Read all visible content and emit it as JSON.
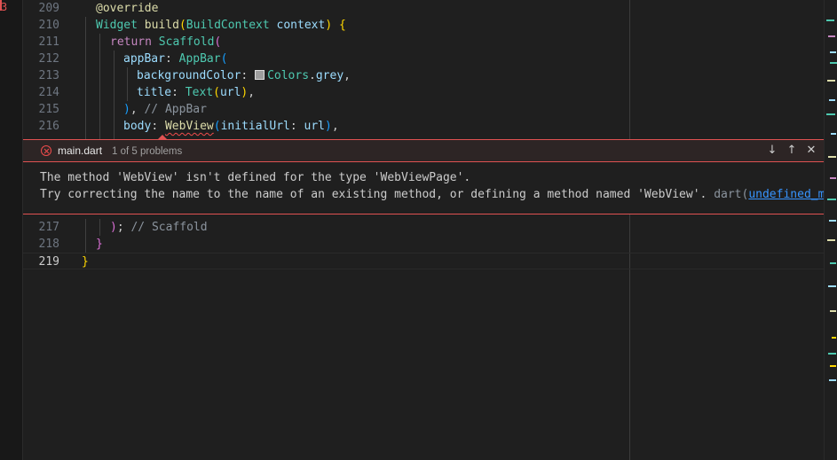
{
  "gutter": {
    "badge": "3"
  },
  "lines": [
    {
      "num": "209",
      "tokens": [
        {
          "t": "@override",
          "c": "anno"
        }
      ]
    },
    {
      "num": "210",
      "tokens": [
        {
          "t": "Widget ",
          "c": "cls"
        },
        {
          "t": "build",
          "c": "fn"
        },
        {
          "t": "(",
          "c": "br1"
        },
        {
          "t": "BuildContext ",
          "c": "cls"
        },
        {
          "t": "context",
          "c": "prm"
        },
        {
          "t": ") ",
          "c": "br1"
        },
        {
          "t": "{",
          "c": "br1"
        }
      ]
    },
    {
      "num": "211",
      "tokens": [
        {
          "t": "return ",
          "c": "kw"
        },
        {
          "t": "Scaffold",
          "c": "cls"
        },
        {
          "t": "(",
          "c": "br2"
        }
      ]
    },
    {
      "num": "212",
      "tokens": [
        {
          "t": "appBar",
          "c": "prm"
        },
        {
          "t": ": ",
          "c": "pn"
        },
        {
          "t": "AppBar",
          "c": "cls"
        },
        {
          "t": "(",
          "c": "br3"
        }
      ]
    },
    {
      "num": "213",
      "tokens": [
        {
          "t": "backgroundColor",
          "c": "prm"
        },
        {
          "t": ": ",
          "c": "pn"
        },
        {
          "t": "",
          "c": "swatch"
        },
        {
          "t": "Colors",
          "c": "cls"
        },
        {
          "t": ".",
          "c": "pn"
        },
        {
          "t": "grey",
          "c": "var"
        },
        {
          "t": ",",
          "c": "pn"
        }
      ]
    },
    {
      "num": "214",
      "tokens": [
        {
          "t": "title",
          "c": "prm"
        },
        {
          "t": ": ",
          "c": "pn"
        },
        {
          "t": "Text",
          "c": "cls"
        },
        {
          "t": "(",
          "c": "br1"
        },
        {
          "t": "url",
          "c": "var"
        },
        {
          "t": ")",
          "c": "br1"
        },
        {
          "t": ",",
          "c": "pn"
        }
      ]
    },
    {
      "num": "215",
      "tokens": [
        {
          "t": ")",
          "c": "br3"
        },
        {
          "t": ", ",
          "c": "pn"
        },
        {
          "t": "// AppBar",
          "c": "cmg"
        }
      ]
    },
    {
      "num": "216",
      "tokens": [
        {
          "t": "body",
          "c": "prm"
        },
        {
          "t": ": ",
          "c": "pn"
        },
        {
          "t": "WebView",
          "c": "fn squig"
        },
        {
          "t": "(",
          "c": "br3"
        },
        {
          "t": "initialUrl",
          "c": "prm"
        },
        {
          "t": ": ",
          "c": "pn"
        },
        {
          "t": "url",
          "c": "var"
        },
        {
          "t": ")",
          "c": "br3"
        },
        {
          "t": ",",
          "c": "pn"
        }
      ]
    },
    {
      "num": "217",
      "tokens": [
        {
          "t": ")",
          "c": "br2"
        },
        {
          "t": "; ",
          "c": "pn"
        },
        {
          "t": "// Scaffold",
          "c": "cmg"
        }
      ]
    },
    {
      "num": "218",
      "tokens": [
        {
          "t": "}",
          "c": "br2"
        }
      ]
    },
    {
      "num": "219",
      "tokens": [
        {
          "t": "}",
          "c": "br1"
        }
      ]
    }
  ],
  "peek": {
    "file": "main.dart",
    "count": "1 of 5 problems",
    "message_line1": "The method 'WebView' isn't defined for the type 'WebViewPage'.",
    "message_line2": "Try correcting the name to the name of an existing method, or defining a method named 'WebView'.",
    "source": "dart(",
    "code": "undefined_method",
    "next_glyph": "↓",
    "prev_glyph": "↑",
    "close_glyph": "✕"
  },
  "colors": {
    "error": "#e05252",
    "background": "#1f1f1f"
  }
}
